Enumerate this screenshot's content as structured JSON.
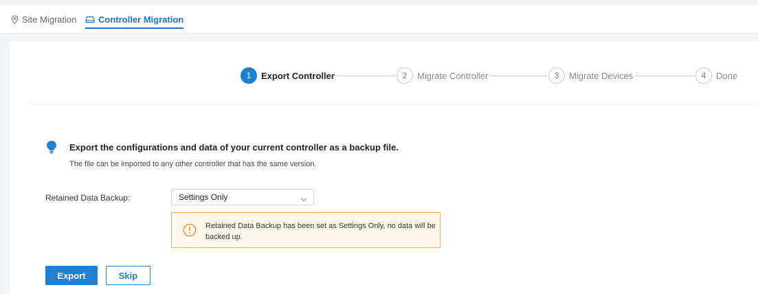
{
  "tabs": {
    "site_migration": "Site Migration",
    "controller_migration": "Controller Migration"
  },
  "steps": [
    {
      "number": "1",
      "label": "Export Controller",
      "active": true
    },
    {
      "number": "2",
      "label": "Migrate Controller",
      "active": false
    },
    {
      "number": "3",
      "label": "Migrate Devices",
      "active": false
    },
    {
      "number": "4",
      "label": "Done",
      "active": false
    }
  ],
  "info": {
    "headline": "Export the configurations and data of your current controller as a backup file.",
    "subline": "The file can be imported to any other controller that has the same version."
  },
  "retained": {
    "label": "Retained Data Backup:",
    "selected": "Settings Only"
  },
  "warning": {
    "text": "Retained Data Backup has been set as Settings Only, no data will be backed up."
  },
  "actions": {
    "export": "Export",
    "skip": "Skip"
  },
  "colors": {
    "accent": "#1f7fd0",
    "warning_border": "#f0a95a",
    "warning_bg": "#fff8ec"
  }
}
